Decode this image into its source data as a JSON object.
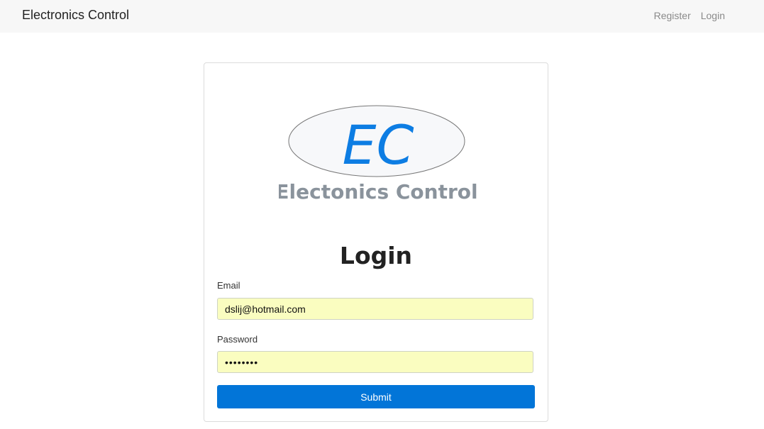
{
  "navbar": {
    "brand": "Electronics Control",
    "links": [
      "Register",
      "Login"
    ]
  },
  "logo": {
    "initials": "EC",
    "wordmark": "Electonics Control",
    "initials_color": "#0d7de3",
    "wordmark_color": "#8a939c"
  },
  "login": {
    "title": "Login",
    "email_label": "Email",
    "email_value": "dslij@hotmail.com",
    "password_label": "Password",
    "password_value": "••••••••",
    "submit_label": "Submit"
  },
  "colors": {
    "primary": "#0275d8",
    "autofill": "#fafdc0",
    "navbar_bg": "#f7f7f7"
  }
}
